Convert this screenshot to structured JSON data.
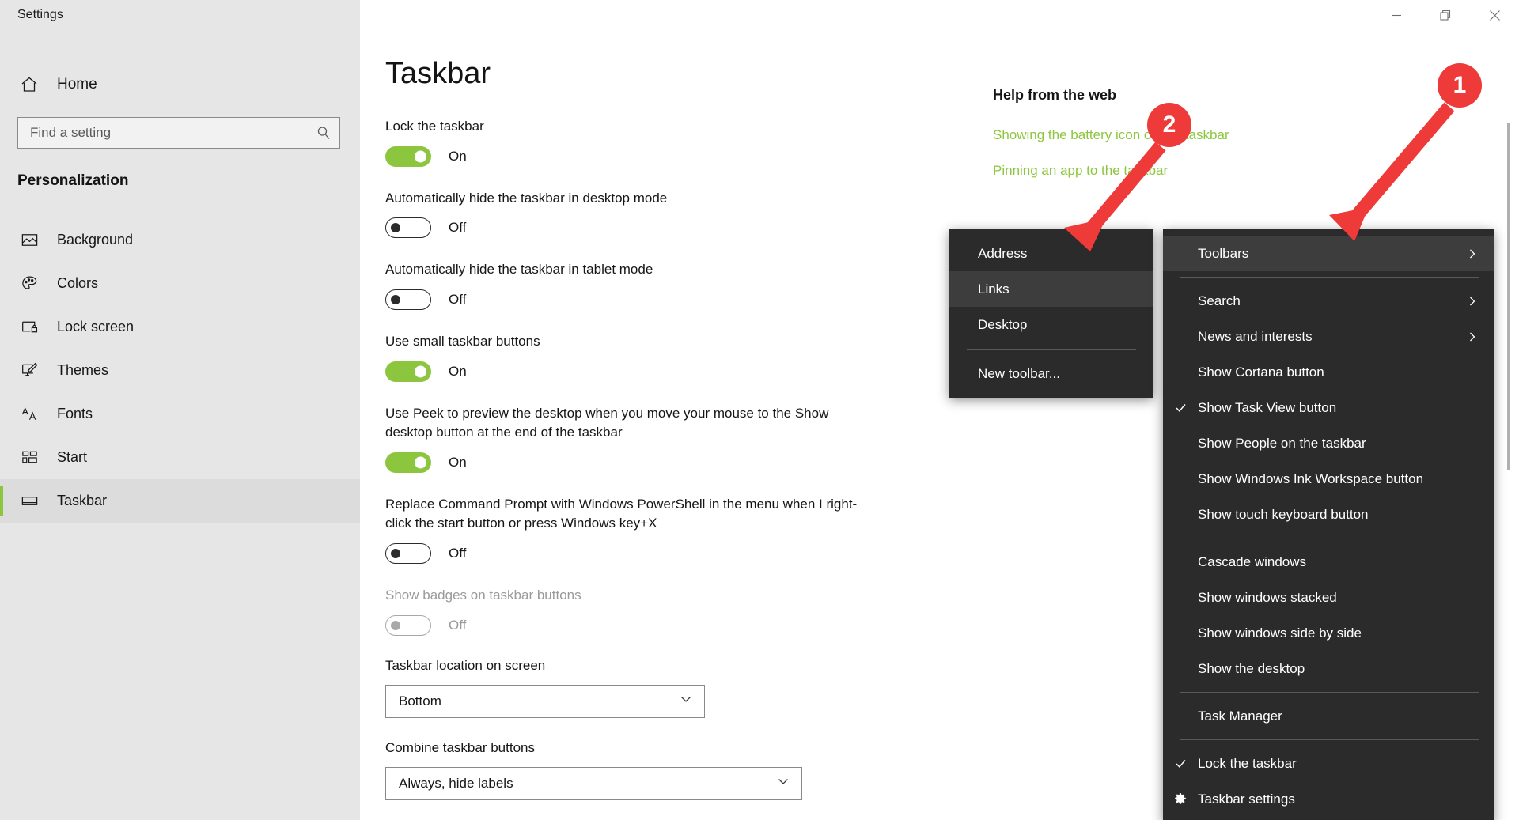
{
  "window": {
    "app_title": "Settings",
    "minimize_label": "Minimize",
    "maximize_label": "Restore",
    "close_label": "Close"
  },
  "sidebar": {
    "home_label": "Home",
    "search_placeholder": "Find a setting",
    "search_value": "",
    "section_title": "Personalization",
    "items": [
      {
        "label": "Background",
        "icon": "image-icon",
        "selected": false
      },
      {
        "label": "Colors",
        "icon": "palette-icon",
        "selected": false
      },
      {
        "label": "Lock screen",
        "icon": "lock-screen-icon",
        "selected": false
      },
      {
        "label": "Themes",
        "icon": "themes-brush-icon",
        "selected": false
      },
      {
        "label": "Fonts",
        "icon": "fonts-aa-icon",
        "selected": false
      },
      {
        "label": "Start",
        "icon": "start-tiles-icon",
        "selected": false
      },
      {
        "label": "Taskbar",
        "icon": "taskbar-icon",
        "selected": true
      }
    ]
  },
  "main": {
    "page_title": "Taskbar",
    "settings": [
      {
        "label": "Lock the taskbar",
        "state": "On",
        "on": true,
        "disabled": false
      },
      {
        "label": "Automatically hide the taskbar in desktop mode",
        "state": "Off",
        "on": false,
        "disabled": false
      },
      {
        "label": "Automatically hide the taskbar in tablet mode",
        "state": "Off",
        "on": false,
        "disabled": false
      },
      {
        "label": "Use small taskbar buttons",
        "state": "On",
        "on": true,
        "disabled": false
      },
      {
        "label": "Use Peek to preview the desktop when you move your mouse to the Show desktop button at the end of the taskbar",
        "state": "On",
        "on": true,
        "disabled": false
      },
      {
        "label": "Replace Command Prompt with Windows PowerShell in the menu when I right-click the start button or press Windows key+X",
        "state": "Off",
        "on": false,
        "disabled": false
      },
      {
        "label": "Show badges on taskbar buttons",
        "state": "Off",
        "on": false,
        "disabled": true
      }
    ],
    "dropdowns": [
      {
        "label": "Taskbar location on screen",
        "value": "Bottom"
      },
      {
        "label": "Combine taskbar buttons",
        "value": "Always, hide labels"
      }
    ]
  },
  "help": {
    "title": "Help from the web",
    "links": [
      "Showing the battery icon on the taskbar",
      "Pinning an app to the taskbar"
    ]
  },
  "context_menu": {
    "items": [
      {
        "label": "Toolbars",
        "checked": false,
        "submenu": true,
        "highlight": true,
        "gear": false
      },
      {
        "separator": true
      },
      {
        "label": "Search",
        "checked": false,
        "submenu": true,
        "highlight": false,
        "gear": false
      },
      {
        "label": "News and interests",
        "checked": false,
        "submenu": true,
        "highlight": false,
        "gear": false
      },
      {
        "label": "Show Cortana button",
        "checked": false,
        "submenu": false,
        "highlight": false,
        "gear": false
      },
      {
        "label": "Show Task View button",
        "checked": true,
        "submenu": false,
        "highlight": false,
        "gear": false
      },
      {
        "label": "Show People on the taskbar",
        "checked": false,
        "submenu": false,
        "highlight": false,
        "gear": false
      },
      {
        "label": "Show Windows Ink Workspace button",
        "checked": false,
        "submenu": false,
        "highlight": false,
        "gear": false
      },
      {
        "label": "Show touch keyboard button",
        "checked": false,
        "submenu": false,
        "highlight": false,
        "gear": false
      },
      {
        "separator": true
      },
      {
        "label": "Cascade windows",
        "checked": false,
        "submenu": false,
        "highlight": false,
        "gear": false
      },
      {
        "label": "Show windows stacked",
        "checked": false,
        "submenu": false,
        "highlight": false,
        "gear": false
      },
      {
        "label": "Show windows side by side",
        "checked": false,
        "submenu": false,
        "highlight": false,
        "gear": false
      },
      {
        "label": "Show the desktop",
        "checked": false,
        "submenu": false,
        "highlight": false,
        "gear": false
      },
      {
        "separator": true
      },
      {
        "label": "Task Manager",
        "checked": false,
        "submenu": false,
        "highlight": false,
        "gear": false
      },
      {
        "separator": true
      },
      {
        "label": "Lock the taskbar",
        "checked": true,
        "submenu": false,
        "highlight": false,
        "gear": false
      },
      {
        "label": "Taskbar settings",
        "checked": false,
        "submenu": false,
        "highlight": false,
        "gear": true
      }
    ]
  },
  "toolbars_submenu": {
    "items": [
      {
        "label": "Address",
        "highlight": false
      },
      {
        "label": "Links",
        "highlight": true
      },
      {
        "label": "Desktop",
        "highlight": false
      },
      {
        "separator": true
      },
      {
        "label": "New toolbar...",
        "highlight": false
      }
    ]
  },
  "annotations": [
    {
      "number": "1"
    },
    {
      "number": "2"
    }
  ],
  "colors": {
    "accent_green": "#8CC63E",
    "annotation_red": "#ef3a3a",
    "menu_background": "#2b2b2b",
    "sidebar_background": "#e6e6e6"
  }
}
